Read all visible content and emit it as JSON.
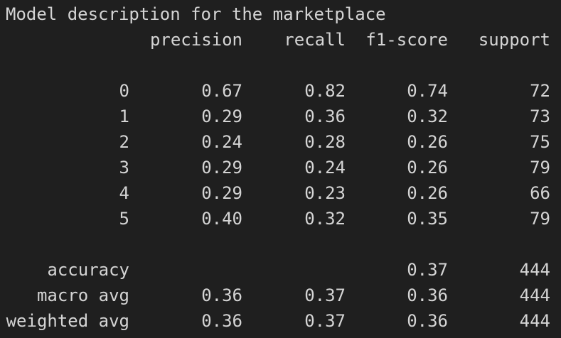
{
  "title": "Model description for the marketplace",
  "headers": [
    "precision",
    "recall",
    "f1-score",
    "support"
  ],
  "rows": [
    {
      "label": "0",
      "precision": "0.67",
      "recall": "0.82",
      "f1": "0.74",
      "support": "72"
    },
    {
      "label": "1",
      "precision": "0.29",
      "recall": "0.36",
      "f1": "0.32",
      "support": "73"
    },
    {
      "label": "2",
      "precision": "0.24",
      "recall": "0.28",
      "f1": "0.26",
      "support": "75"
    },
    {
      "label": "3",
      "precision": "0.29",
      "recall": "0.24",
      "f1": "0.26",
      "support": "79"
    },
    {
      "label": "4",
      "precision": "0.29",
      "recall": "0.23",
      "f1": "0.26",
      "support": "66"
    },
    {
      "label": "5",
      "precision": "0.40",
      "recall": "0.32",
      "f1": "0.35",
      "support": "79"
    }
  ],
  "summary": [
    {
      "label": "accuracy",
      "precision": "",
      "recall": "",
      "f1": "0.37",
      "support": "444"
    },
    {
      "label": "macro avg",
      "precision": "0.36",
      "recall": "0.37",
      "f1": "0.36",
      "support": "444"
    },
    {
      "label": "weighted avg",
      "precision": "0.36",
      "recall": "0.37",
      "f1": "0.36",
      "support": "444"
    }
  ]
}
